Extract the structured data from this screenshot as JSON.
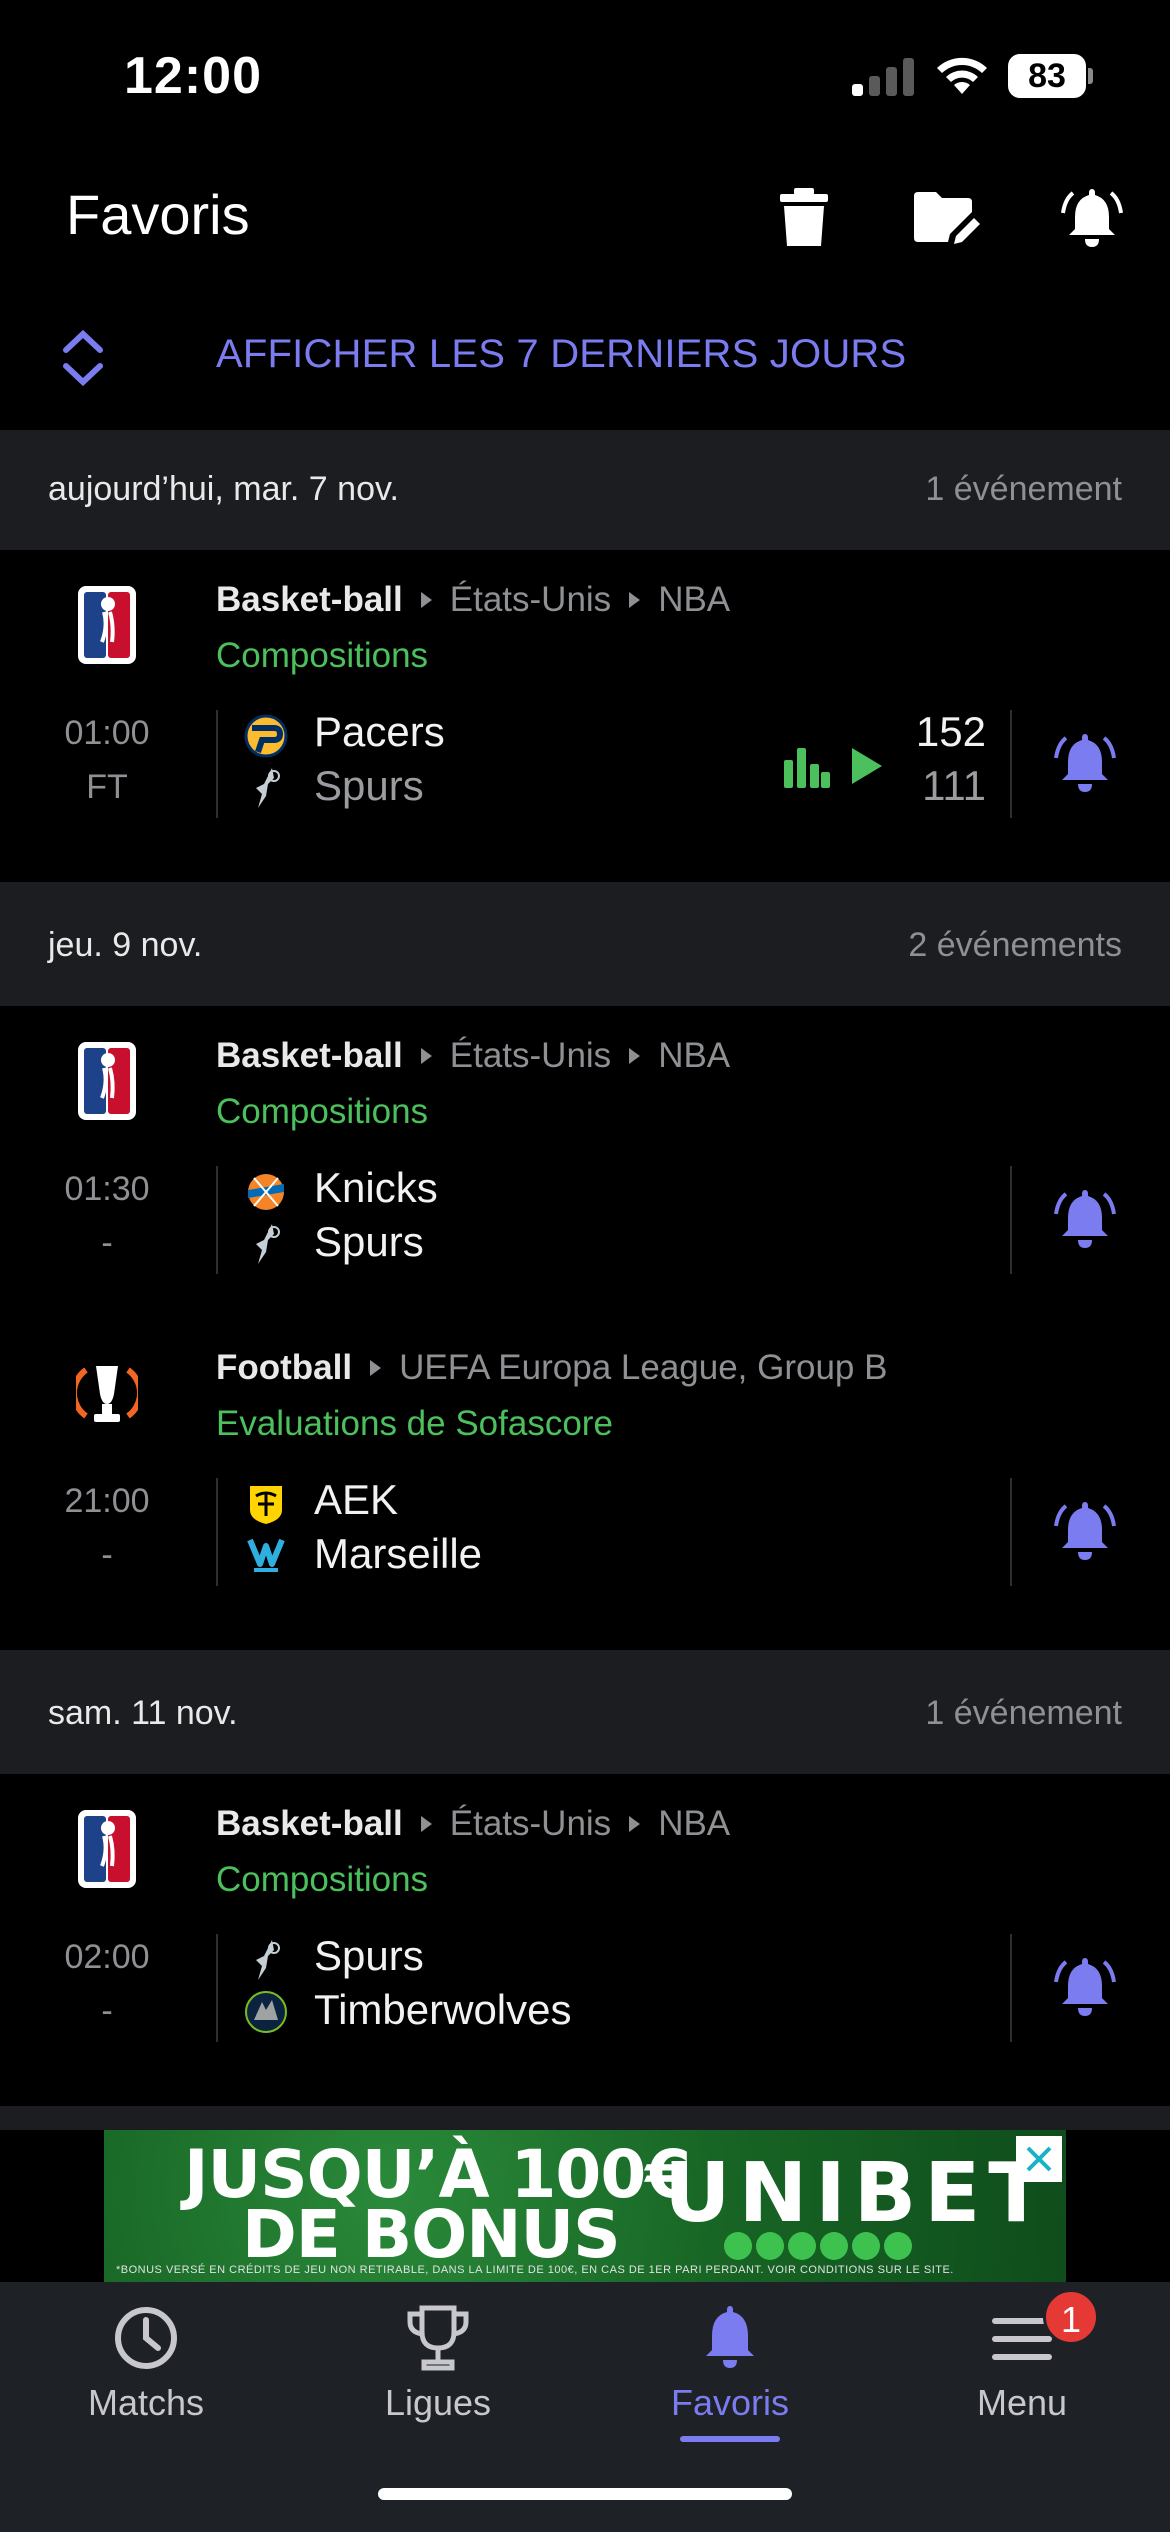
{
  "status_bar": {
    "time": "12:00",
    "battery": "83"
  },
  "header": {
    "title": "Favoris"
  },
  "last_days": {
    "label": "AFFICHER LES 7 DERNIERS JOURS"
  },
  "days": [
    {
      "date": "aujourd’hui, mar. 7 nov.",
      "count": "1 événement",
      "events": [
        {
          "sport": "Basket-ball",
          "country": "États-Unis",
          "league": "NBA",
          "sub": "Compositions",
          "time": "01:00",
          "status": "FT",
          "home": "Pacers",
          "away": "Spurs",
          "home_score": "152",
          "away_score": "111"
        }
      ]
    },
    {
      "date": "jeu. 9 nov.",
      "count": "2 événements",
      "events": [
        {
          "sport": "Basket-ball",
          "country": "États-Unis",
          "league": "NBA",
          "sub": "Compositions",
          "time": "01:30",
          "status": "-",
          "home": "Knicks",
          "away": "Spurs"
        },
        {
          "sport": "Football",
          "league": "UEFA Europa League, Group B",
          "sub": "Evaluations de Sofascore",
          "time": "21:00",
          "status": "-",
          "home": "AEK",
          "away": "Marseille"
        }
      ]
    },
    {
      "date": "sam. 11 nov.",
      "count": "1 événement",
      "events": [
        {
          "sport": "Basket-ball",
          "country": "États-Unis",
          "league": "NBA",
          "sub": "Compositions",
          "time": "02:00",
          "status": "-",
          "home": "Spurs",
          "away": "Timberwolves"
        }
      ]
    }
  ],
  "ad": {
    "line1": "JUSQU’À 100€",
    "line2": "DE BONUS",
    "brand": "UNIBET",
    "fine_print": "*BONUS VERSÉ EN CRÉDITS DE JEU NON RETIRABLE, DANS LA LIMITE DE 100€, EN CAS DE 1ER PARI PERDANT. VOIR CONDITIONS SUR LE SITE."
  },
  "tabs": [
    {
      "label": "Matchs",
      "icon": "clock-icon"
    },
    {
      "label": "Ligues",
      "icon": "trophy-icon"
    },
    {
      "label": "Favoris",
      "icon": "bell-icon",
      "active": true
    },
    {
      "label": "Menu",
      "icon": "menu-icon",
      "badge": "1"
    }
  ],
  "colors": {
    "accent": "#7b7cf0",
    "green": "#4cc05c",
    "badge": "#e53935",
    "section_bg": "#1b1d20"
  }
}
